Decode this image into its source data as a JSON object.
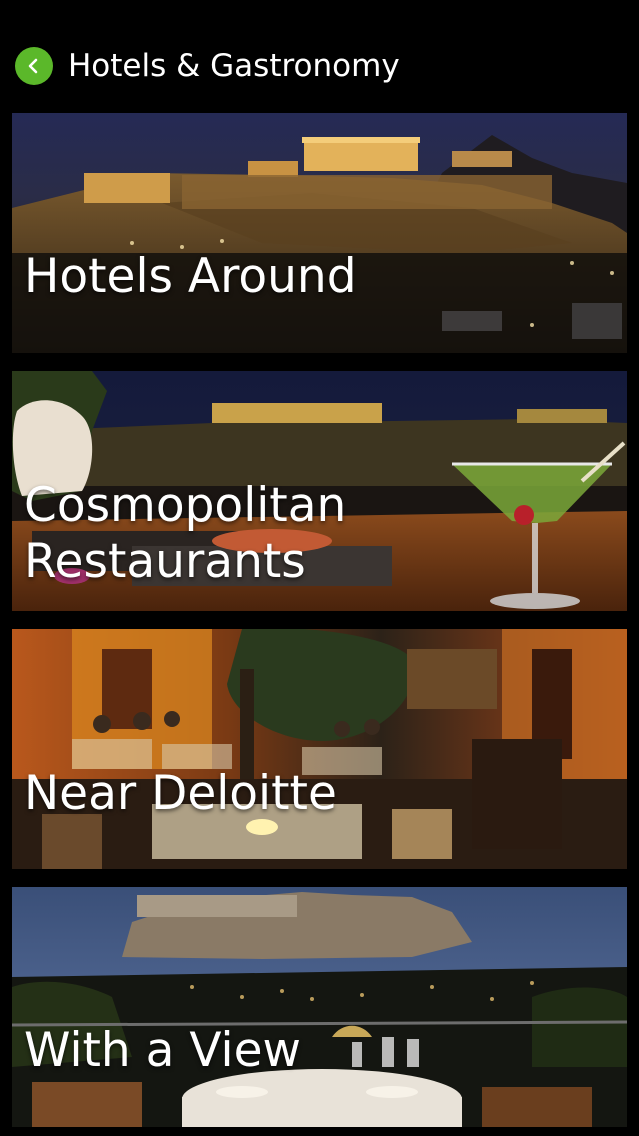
{
  "header": {
    "title": "Hotels & Gastronomy",
    "back_icon": "chevron-left-icon",
    "accent_color": "#5bb82a"
  },
  "cards": [
    {
      "label": "Hotels Around"
    },
    {
      "label": "Cosmopolitan\nRestaurants"
    },
    {
      "label": "Near Deloitte"
    },
    {
      "label": "With a View"
    }
  ]
}
